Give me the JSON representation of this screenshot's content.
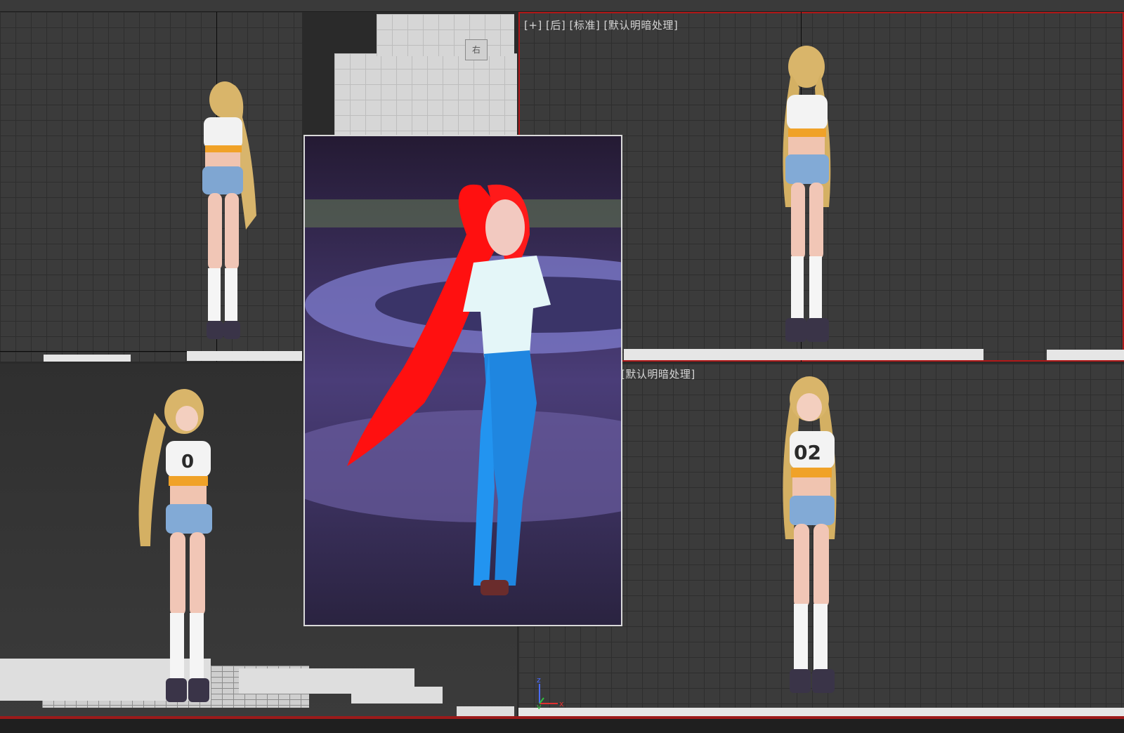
{
  "viewports": {
    "top_right_label": "[+] [后] [标准] [默认明暗处理]",
    "bottom_right_label": "[默认明暗处理]"
  },
  "nav_cube": {
    "label": "右"
  },
  "axis_gizmo": {
    "z_label": "z",
    "y_label": "y",
    "x_label": "x"
  },
  "colors": {
    "active_viewport_border": "#b01818",
    "grid_line": "#2e2e2e",
    "viewport_bg": "#3b3b3b",
    "status_accent": "#9c1a1a"
  }
}
